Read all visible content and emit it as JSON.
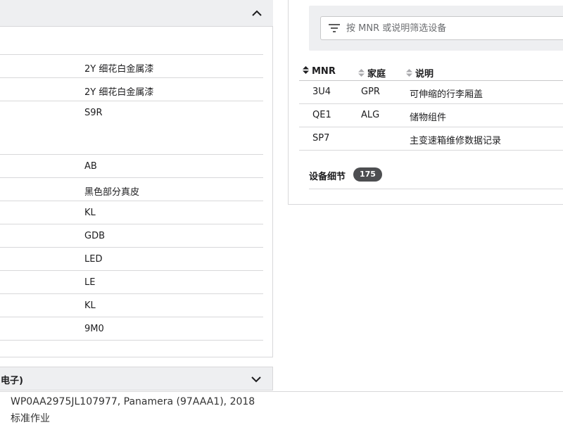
{
  "left_list": {
    "rows": [
      {
        "value": "2Y 细花白金属漆"
      },
      {
        "value": "2Y 细花白金属漆"
      },
      {
        "value": "S9R"
      },
      {
        "value": "AB"
      },
      {
        "value": "黑色部分真皮"
      },
      {
        "value": "KL"
      },
      {
        "value": "GDB"
      },
      {
        "value": "LED"
      },
      {
        "value": "LE"
      },
      {
        "value": "KL"
      },
      {
        "value": "9M0"
      }
    ]
  },
  "section2": {
    "label": "电子)"
  },
  "filter": {
    "placeholder": "按 MNR 或说明筛选设备"
  },
  "equipment_table": {
    "headers": {
      "mnr": "MNR",
      "family": "家庭",
      "description": "说明"
    },
    "rows": [
      {
        "mnr": "3U4",
        "family": "GPR",
        "description": "可伸缩的行李厢盖"
      },
      {
        "mnr": "QE1",
        "family": "ALG",
        "description": "储物组件"
      },
      {
        "mnr": "SP7",
        "family": "",
        "description": "主变速箱维修数据记录"
      }
    ]
  },
  "details": {
    "label": "设备细节",
    "count": "175"
  },
  "footer": {
    "vehicle": "WP0AA2975JL107977, Panamera (97AAA1), 2018",
    "mode": "标准作业"
  }
}
